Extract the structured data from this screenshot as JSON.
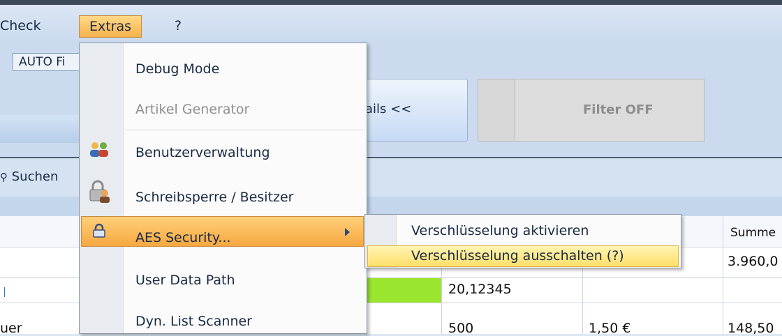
{
  "menubar": {
    "check": "Check",
    "extras": "Extras",
    "help": "?"
  },
  "toolbar": {
    "auto_filter": "AUTO Fi",
    "details_button": "ails <<",
    "filter_button": "Filter OFF"
  },
  "search": {
    "label": "Suchen"
  },
  "grid": {
    "header_summe": "Summe",
    "row1": {
      "summe": "3.960,0"
    },
    "row2": {
      "col_value": "20,12345"
    },
    "row3": {
      "col_name": "uer",
      "col_value": "500",
      "col_price": "1,50 €",
      "summe": "148,50"
    }
  },
  "dropdown": {
    "items": [
      {
        "label": "Debug Mode",
        "enabled": true
      },
      {
        "label": "Artikel Generator",
        "enabled": false
      },
      {
        "label": "Benutzerverwaltung",
        "enabled": true,
        "icon": "users-icon"
      },
      {
        "label": "Schreibsperre / Besitzer",
        "enabled": true,
        "icon": "lock-user-icon"
      },
      {
        "label": "AES Security...",
        "enabled": true,
        "icon": "padlock-icon",
        "highlighted": true
      },
      {
        "label": "User Data Path",
        "enabled": true
      },
      {
        "label": "Dyn. List Scanner",
        "enabled": true
      }
    ]
  },
  "submenu": {
    "items": [
      {
        "label": "Verschlüsselung aktivieren"
      },
      {
        "label": "Verschlüsselung ausschalten (?)",
        "highlighted": true
      }
    ]
  },
  "colors": {
    "menu_highlight": "#f6b24c",
    "submenu_highlight": "#ffdf6a",
    "green_cell": "#9ae62f"
  }
}
